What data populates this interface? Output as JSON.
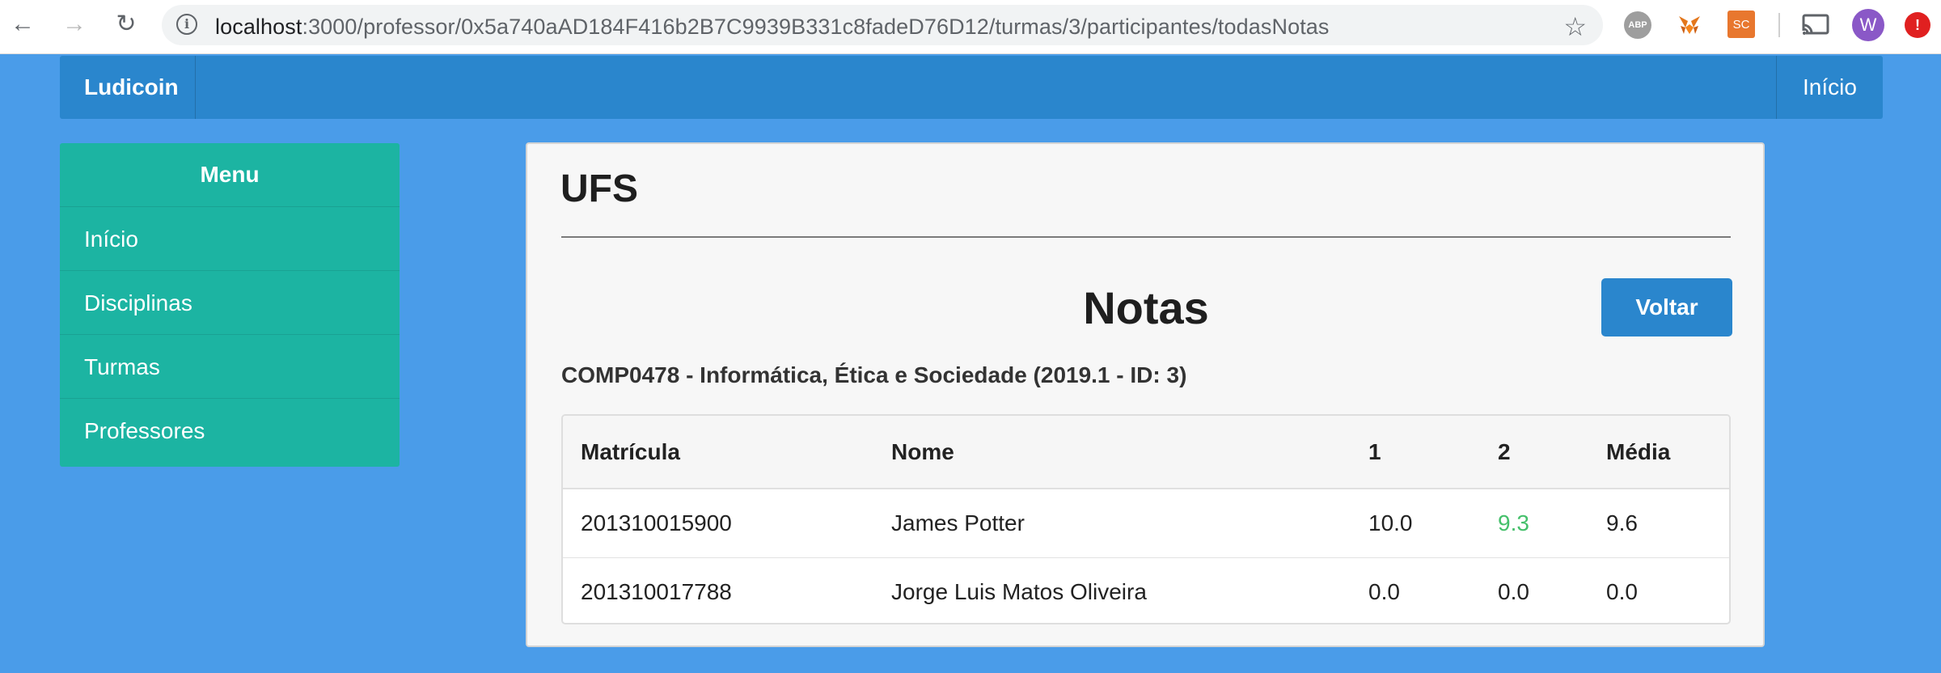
{
  "browser": {
    "url_host": "localhost",
    "url_path": ":3000/professor/0x5a740aAD184F416b2B7C9939B331c8fadeD76D12/turmas/3/participantes/todasNotas",
    "ext_abp": "ABP",
    "ext_sc": "SC",
    "user_initial": "W",
    "update_icon": "!"
  },
  "navbar": {
    "brand": "Ludicoin",
    "home": "Início"
  },
  "sidebar": {
    "title": "Menu",
    "items": [
      {
        "label": "Início"
      },
      {
        "label": "Disciplinas"
      },
      {
        "label": "Turmas"
      },
      {
        "label": "Professores"
      }
    ]
  },
  "main": {
    "title": "UFS",
    "section_title": "Notas",
    "back_label": "Voltar",
    "class_info": "COMP0478 - Informática, Ética e Sociedade (2019.1 - ID: 3)",
    "table": {
      "headers": [
        "Matrícula",
        "Nome",
        "1",
        "2",
        "Média"
      ],
      "rows": [
        {
          "matricula": "201310015900",
          "nome": "James Potter",
          "n1": "10.0",
          "n2": "9.3",
          "media": "9.6"
        },
        {
          "matricula": "201310017788",
          "nome": "Jorge Luis Matos Oliveira",
          "n1": "0.0",
          "n2": "0.0",
          "media": "0.0"
        }
      ]
    }
  },
  "colors": {
    "page_bg": "#4a9ce9",
    "navbar": "#2a86cd",
    "sidebar": "#1cb4a2",
    "button": "#2a86cd",
    "highlight_grade": "#45c06b"
  }
}
